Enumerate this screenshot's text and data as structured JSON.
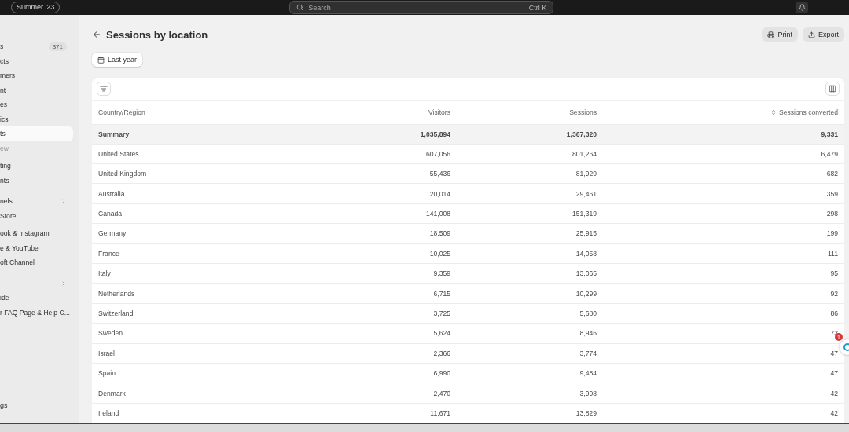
{
  "topbar": {
    "badge": "Summer '23",
    "search": {
      "placeholder": "Search",
      "shortcut": "Ctrl K"
    }
  },
  "sidebar": {
    "items": [
      {
        "label": "s",
        "count": "371",
        "selected": false,
        "muted": false,
        "chevron": false
      },
      {
        "label": "cts",
        "selected": false,
        "muted": false,
        "chevron": false
      },
      {
        "label": "mers",
        "selected": false,
        "muted": false,
        "chevron": false
      },
      {
        "label": "nt",
        "selected": false,
        "muted": false,
        "chevron": false
      },
      {
        "label": "es",
        "selected": false,
        "muted": false,
        "chevron": false
      },
      {
        "label": "ics",
        "selected": false,
        "muted": false,
        "chevron": false
      },
      {
        "label": "ts",
        "selected": true,
        "muted": false,
        "chevron": false
      },
      {
        "label": "ew",
        "selected": false,
        "muted": true,
        "chevron": false
      },
      {
        "kind": "gap"
      },
      {
        "label": "ting",
        "selected": false,
        "muted": false,
        "chevron": false
      },
      {
        "label": "nts",
        "selected": false,
        "muted": false,
        "chevron": false
      },
      {
        "kind": "gap"
      },
      {
        "label": "nels",
        "selected": false,
        "muted": false,
        "chevron": true
      },
      {
        "label": "Store",
        "selected": false,
        "muted": false,
        "chevron": false
      },
      {
        "kind": "gap"
      },
      {
        "label": "ook & Instagram",
        "selected": false,
        "muted": false,
        "chevron": false
      },
      {
        "label": "e & YouTube",
        "selected": false,
        "muted": false,
        "chevron": false
      },
      {
        "label": "oft Channel",
        "selected": false,
        "muted": false,
        "chevron": false
      },
      {
        "kind": "gap"
      },
      {
        "selected": false,
        "muted": false,
        "chevron": true
      },
      {
        "label": "ide",
        "selected": false,
        "muted": false,
        "chevron": false
      },
      {
        "label": "r FAQ Page & Help C...",
        "selected": false,
        "muted": false,
        "chevron": false
      }
    ],
    "footer": "gs"
  },
  "page": {
    "title": "Sessions by location",
    "actions": [
      "Print",
      "Export"
    ],
    "date_filter": "Last year"
  },
  "table": {
    "columns": [
      "Country/Region",
      "Visitors",
      "Sessions",
      "Sessions converted"
    ],
    "summary": [
      "Summary",
      "1,035,894",
      "1,367,320",
      "9,331"
    ],
    "rows": [
      [
        "United States",
        "607,056",
        "801,264",
        "6,479"
      ],
      [
        "United Kingdom",
        "55,436",
        "81,929",
        "682"
      ],
      [
        "Australia",
        "20,014",
        "29,461",
        "359"
      ],
      [
        "Canada",
        "141,008",
        "151,319",
        "298"
      ],
      [
        "Germany",
        "18,509",
        "25,915",
        "199"
      ],
      [
        "France",
        "10,025",
        "14,058",
        "111"
      ],
      [
        "Italy",
        "9,359",
        "13,065",
        "95"
      ],
      [
        "Netherlands",
        "6,715",
        "10,299",
        "92"
      ],
      [
        "Switzerland",
        "3,725",
        "5,680",
        "86"
      ],
      [
        "Sweden",
        "5,624",
        "8,946",
        "73"
      ],
      [
        "Israel",
        "2,366",
        "3,774",
        "47"
      ],
      [
        "Spain",
        "6,990",
        "9,484",
        "47"
      ],
      [
        "Denmark",
        "2,470",
        "3,998",
        "42"
      ],
      [
        "Ireland",
        "11,671",
        "13,829",
        "42"
      ]
    ]
  },
  "widget": {
    "badge": "1"
  }
}
